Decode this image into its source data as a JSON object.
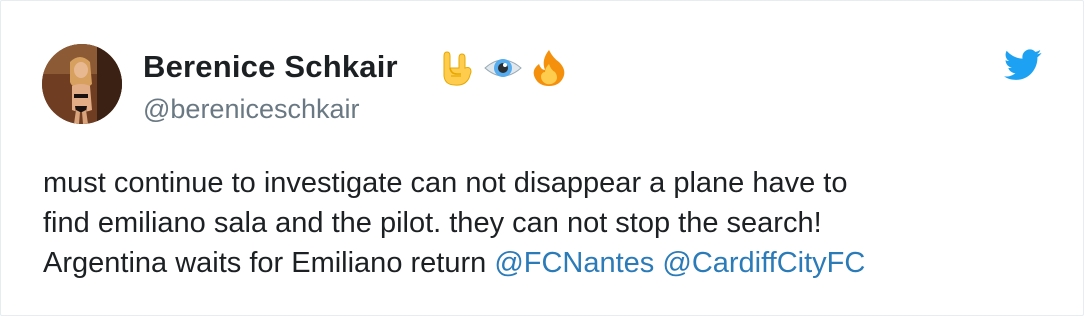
{
  "author": {
    "name": "Berenice Schkair",
    "handle": "@bereniceschkair",
    "name_emojis": [
      "sign-of-the-horns-emoji",
      "eye-emoji",
      "fire-emoji"
    ]
  },
  "tweet": {
    "line1": "must continue to investigate can not disappear a plane have to",
    "line2": "find emiliano sala and the pilot. they can not stop the search!",
    "line3_text": "Argentina waits for Emiliano return",
    "mentions": [
      "@FCNantes",
      "@CardiffCityFC"
    ]
  },
  "colors": {
    "text": "#1c2022",
    "secondary": "#697882",
    "link": "#2b7bb9",
    "twitter_blue": "#1da1f2"
  },
  "icons": {
    "platform": "twitter-bird-icon"
  }
}
